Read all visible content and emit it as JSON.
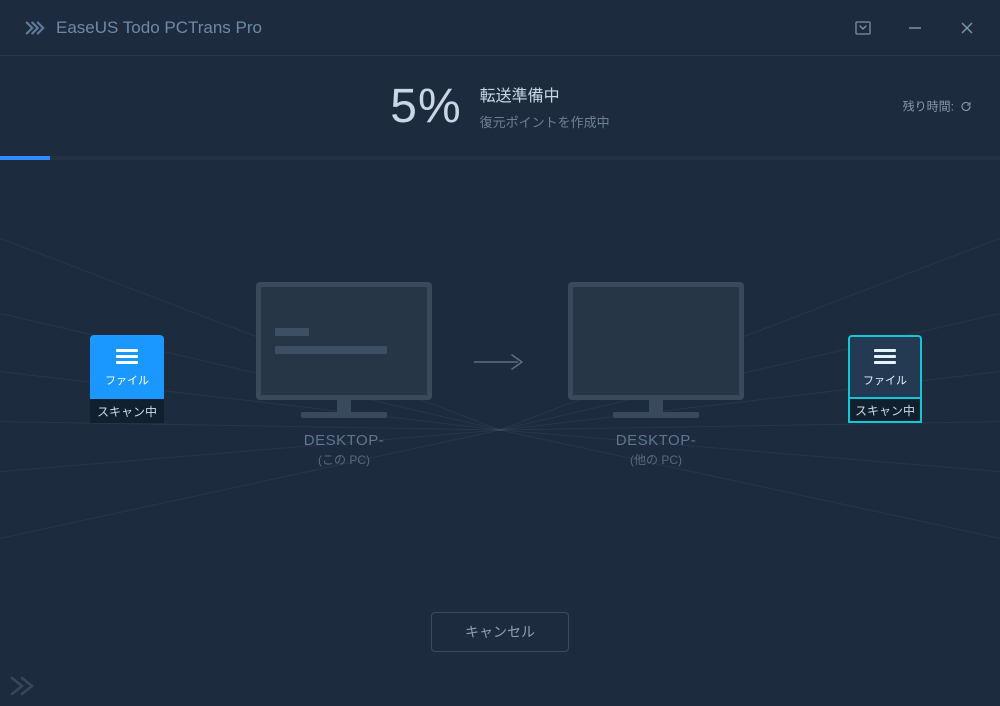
{
  "header": {
    "app_title": "EaseUS Todo PCTrans Pro"
  },
  "status": {
    "percent_text": "5%",
    "percent_value": 5,
    "title": "転送準備中",
    "subtitle": "復元ポイントを作成中",
    "time_remaining_label": "残り時間:"
  },
  "colors": {
    "accent_blue": "#1a98ff",
    "accent_cyan": "#14c7d4"
  },
  "tile_left": {
    "label": "ファイル",
    "status": "スキャン中"
  },
  "tile_right": {
    "label": "ファイル",
    "status": "スキャン中"
  },
  "source_pc": {
    "name": "DESKTOP-",
    "role": "(この PC)"
  },
  "target_pc": {
    "name": "DESKTOP-",
    "role": "(他の PC)"
  },
  "buttons": {
    "cancel": "キャンセル"
  }
}
